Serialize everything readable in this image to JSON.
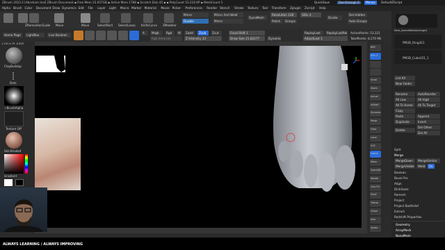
{
  "titlebar": {
    "text": "ZBrush 2023.2 [Abraham leal]   ZBrush Document   ▪ Free Mem 23.057GB ▪ Active Mem 1788 ▪ Scratch Disk 45 ▪ ▪ PolyCount 53.216 KP ▪ MeshCount 1",
    "quicksave": "QuickSave",
    "seethrough": "See-through 0",
    "menus_label": "Menus",
    "defaultscript": "DefaultZScript"
  },
  "menubar": [
    "Alpha",
    "Brush",
    "Color",
    "Document",
    "Draw",
    "Dynamics",
    "Edit",
    "File",
    "Layer",
    "Light",
    "Macro",
    "Marker",
    "Material",
    "Movie",
    "Picker",
    "Preferences",
    "Render",
    "Stencil",
    "Stroke",
    "Texture",
    "Tool",
    "Transform",
    "Zplugin",
    "Zscript",
    "Help"
  ],
  "topshelf": {
    "buttons": [
      {
        "label": "ZRemesherGuide"
      },
      {
        "label": "Move"
      },
      {
        "label": "Move"
      },
      {
        "label": "SelectRect"
      },
      {
        "label": "SelectLasso"
      },
      {
        "label": "KnifeCurve"
      },
      {
        "label": "ZModeler"
      }
    ],
    "mirror": "Mirror",
    "mirror_weld": "Mirror And Weld",
    "dynamesh": "DynaMesh",
    "double": "Double",
    "mirror2": "Mirror",
    "resolution_label": "Resolution 128",
    "polish_label": "Polish",
    "groups_label": "Groups",
    "sdiv_label": "SDiv 4",
    "divide": "Divide",
    "del_hidden": "Del Hidden",
    "auto_groups": "Auto Groups"
  },
  "tools2": {
    "home_page": "Home Page",
    "lightbox": "LightBox",
    "live_boolean": "Live Boolean",
    "edit": "Edit",
    "draw": "Draw",
    "move": "Move",
    "scale": "Scale",
    "rotate": "Rotate",
    "a_label": "A",
    "mrgb": "Mrgb",
    "rgb": "Rgb",
    "m": "M",
    "zadd": "Zadd",
    "zsub": "Zsub",
    "zcut": "Zcut",
    "rgb_intensity": "Rgb Intensity",
    "z_intensity": "Z Intensity 33",
    "focal_shift": "Focal Shift 1",
    "draw_size": "Draw Size 21.82277",
    "dynamic": "Dynamic",
    "replay_last": "ReplayLast",
    "replay_last_rel": "ReplayLastRel",
    "adjust_last": "AdjustLast 1",
    "active_points": "ActivePoints: 53,321",
    "total_points": "TotalPoints: 8.270 Mil"
  },
  "leftshelf": {
    "brush_label": "ClayBuildup",
    "stroke_label": "Dots",
    "alpha_label": "~BrushAlpha",
    "texture_label": "Texture Off",
    "material_label": "SkinShade4",
    "gradient_label": "Gradient",
    "switch_label": "SwitchColor",
    "coords": "1.191 4.79 -0.825"
  },
  "rightshelf": {
    "labels": [
      "BPR",
      "SPix 3",
      "",
      "",
      "Scroll",
      "Zoom",
      "Actual",
      "AAHalf",
      "Dynamic",
      "Persp",
      "Floor",
      "Local",
      "XYZ",
      "Frame",
      "Move",
      "Zoom3D",
      "Rotate",
      "Line Fill",
      "PolyF",
      "Transp",
      "Ghost",
      "Solo",
      "Xpose"
    ]
  },
  "rpanel": {
    "tool_name": "Nick_bamaMaleAverage1",
    "subtools": [
      "PM3D_Ring321",
      "PM3D_Cube321_1"
    ],
    "list_all": "List All",
    "new_folder": "New Folder",
    "rename": "Rename",
    "auto_reorder": "AutoReorder",
    "all_low": "All Low",
    "all_high": "All High",
    "all_to_home": "All To Home",
    "all_to_target": "All To Target",
    "copy": "Copy",
    "paste": "Paste",
    "duplicate": "Duplicate",
    "append": "Append",
    "insert": "Insert",
    "delete": "Delete",
    "del_other": "Del Other",
    "del_all": "Del All",
    "split": "Split",
    "merge": "Merge",
    "merge_down": "MergeDown",
    "merge_similar": "MergeSimilar",
    "merge_visible": "MergeVisible",
    "weld": "Weld",
    "uv": "Uv",
    "boolean": "Boolean",
    "bevel_pro": "Bevel Pro",
    "align": "Align",
    "distribute": "Distribute",
    "remesh": "Remesh",
    "project": "Project",
    "project_bas": "Project BasRelief",
    "extract": "Extract",
    "redshift": "Redshift Properties",
    "geometry": "Geometry",
    "arraymesh": "ArrayMesh",
    "nanomesh": "NanoMesh"
  },
  "bottombar": {
    "tagline": "ALWAYS LEARNING  / ALWAYS IMPROVING"
  }
}
